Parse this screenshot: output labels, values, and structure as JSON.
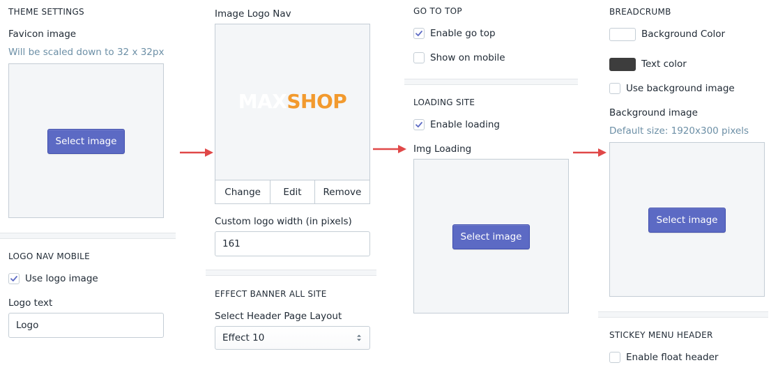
{
  "colors": {
    "accent": "#5c6ac4",
    "arrow": "#e04848",
    "text_color_swatch": "#3d3d3d",
    "bg_color_swatch": "#ffffff",
    "logo_max": "#ffffff",
    "logo_shop": "#f29a2e"
  },
  "theme_settings": {
    "title": "THEME SETTINGS",
    "favicon_label": "Favicon image",
    "favicon_hint": "Will be scaled down to 32 x 32px",
    "select_image": "Select image"
  },
  "logo_nav_mobile": {
    "title": "LOGO NAV MOBILE",
    "use_logo_label": "Use logo image",
    "use_logo_checked": true,
    "logo_text_label": "Logo text",
    "logo_text_value": "Logo"
  },
  "image_logo_nav": {
    "label": "Image Logo Nav",
    "logo_part1": "MAX",
    "logo_part2": "SHOP",
    "actions": {
      "change": "Change",
      "edit": "Edit",
      "remove": "Remove"
    },
    "custom_width_label": "Custom logo width (in pixels)",
    "custom_width_value": "161"
  },
  "effect_banner": {
    "title": "EFFECT BANNER ALL SITE",
    "layout_label": "Select Header Page Layout",
    "layout_value": "Effect 10"
  },
  "go_to_top": {
    "title": "GO TO TOP",
    "enable_label": "Enable go top",
    "enable_checked": true,
    "mobile_label": "Show on mobile",
    "mobile_checked": false
  },
  "loading_site": {
    "title": "LOADING SITE",
    "enable_label": "Enable loading",
    "enable_checked": true,
    "img_label": "Img Loading",
    "select_image": "Select image"
  },
  "breadcrumb": {
    "title": "BREADCRUMB",
    "bg_color_label": "Background Color",
    "text_color_label": "Text color",
    "use_bg_label": "Use background image",
    "use_bg_checked": false,
    "bg_image_label": "Background image",
    "bg_image_hint": "Default size: 1920x300 pixels",
    "select_image": "Select image"
  },
  "sticky_menu": {
    "title": "STICKEY MENU HEADER",
    "float_label": "Enable float header",
    "float_checked": false
  }
}
